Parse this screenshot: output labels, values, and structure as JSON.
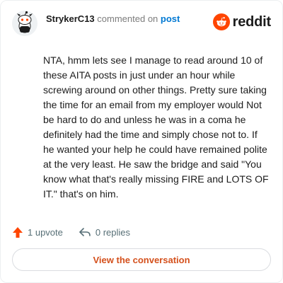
{
  "header": {
    "username": "StrykerC13",
    "action_text": "commented on",
    "target_text": "post",
    "brand_name": "reddit",
    "brand_color": "#ff4500"
  },
  "comment": {
    "body": "NTA, hmm lets see I manage to read around 10 of these AITA posts in just under an hour while screwing around on other things. Pretty sure taking the time for an email from my employer would Not be hard to do and unless he was in a coma he definitely had the time and simply chose not to. If he wanted your help he could have remained polite at the very least. He saw the bridge and said \"You know what that's really missing FIRE and LOTS OF IT.\" that's on him."
  },
  "actions": {
    "upvote_label": "1 upvote",
    "replies_label": "0 replies",
    "upvote_icon": "upvote-arrow-icon",
    "reply_icon": "reply-arrow-icon"
  },
  "footer": {
    "view_button_label": "View the conversation",
    "view_button_color": "#d4501c"
  }
}
